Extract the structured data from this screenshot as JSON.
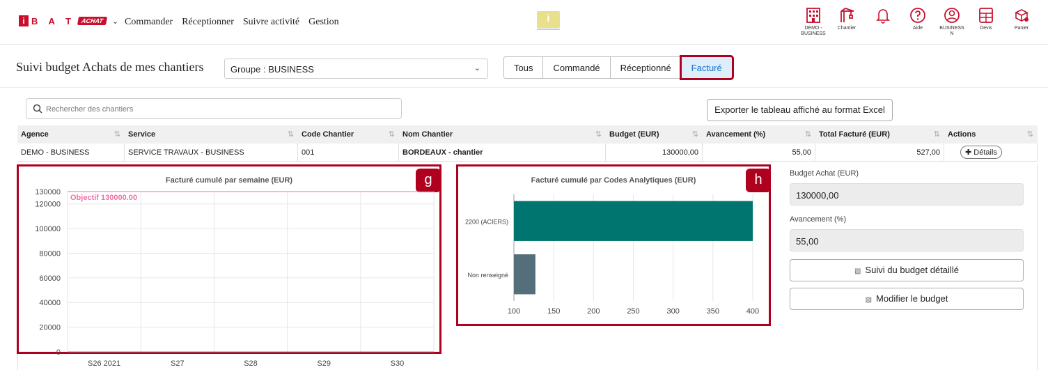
{
  "header": {
    "logo_letters": "B A T",
    "logo_i": "i",
    "logo_badge": "ACHAT",
    "nav": [
      "Commander",
      "Réceptionner",
      "Suivre activité",
      "Gestion"
    ],
    "center_logo": "i",
    "icons": [
      {
        "name": "building-icon",
        "label": "DEMO - BUSINESS"
      },
      {
        "name": "crane-icon",
        "label": "Chantier"
      },
      {
        "name": "bell-icon",
        "label": ""
      },
      {
        "name": "help-icon",
        "label": "Aide"
      },
      {
        "name": "user-icon",
        "label": "BUSINESS N"
      },
      {
        "name": "calculator-icon",
        "label": "Devis"
      },
      {
        "name": "cart-icon",
        "label": "Panier"
      }
    ],
    "accent": "#c8102e"
  },
  "page": {
    "title": "Suivi budget Achats de mes chantiers",
    "group_select": "Groupe : BUSINESS",
    "filters": [
      "Tous",
      "Commandé",
      "Réceptionné",
      "Facturé"
    ],
    "active_filter": "Facturé",
    "search_placeholder": "Rechercher des chantiers",
    "export_label": "Exporter le tableau affiché au format Excel"
  },
  "table": {
    "columns": [
      "Agence",
      "Service",
      "Code Chantier",
      "Nom Chantier",
      "Budget (EUR)",
      "Avancement (%)",
      "Total Facturé (EUR)",
      "Actions"
    ],
    "rows": [
      {
        "agence": "DEMO - BUSINESS",
        "service": "SERVICE TRAVAUX - BUSINESS",
        "code": "001",
        "nom": "BORDEAUX - chantier",
        "budget": "130000,00",
        "avancement": "55,00",
        "total": "527,00",
        "action": "Détails"
      }
    ]
  },
  "chart_g": {
    "badge": "g",
    "chart_data": {
      "type": "line",
      "title": "Facturé cumulé par semaine (EUR)",
      "categories": [
        "S26 2021",
        "S27",
        "S28",
        "S29",
        "S30"
      ],
      "yticks": [
        0,
        20000,
        40000,
        60000,
        80000,
        100000,
        120000,
        130000
      ],
      "ylim": [
        0,
        130000
      ],
      "target": {
        "label": "Objectif 130000.00",
        "value": 130000,
        "color": "#f06eaa"
      },
      "series": []
    }
  },
  "chart_h": {
    "badge": "h",
    "chart_data": {
      "type": "bar",
      "orientation": "horizontal",
      "title": "Facturé cumulé par Codes Analytiques (EUR)",
      "categories": [
        "2200 (ACIERS)",
        "Non renseigné"
      ],
      "values": [
        400,
        127
      ],
      "colors": [
        "#007570",
        "#546e7a"
      ],
      "xlim": [
        100,
        400
      ],
      "xticks": [
        100,
        150,
        200,
        250,
        300,
        350,
        400
      ]
    }
  },
  "side_panel": {
    "budget_label": "Budget Achat (EUR)",
    "budget_value": "130000,00",
    "avancement_label": "Avancement (%)",
    "avancement_value": "55,00",
    "btn_suivi": "Suivi du budget détaillé",
    "btn_modifier": "Modifier le budget"
  }
}
